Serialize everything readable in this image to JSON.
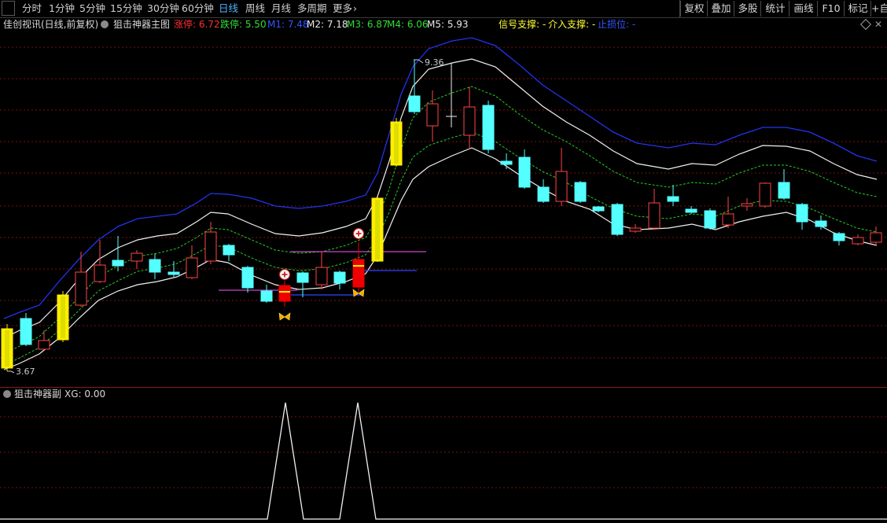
{
  "toolbar": {
    "left_box": "□",
    "periods": [
      "分时",
      "1分钟",
      "5分钟",
      "15分钟",
      "30分钟",
      "60分钟",
      "日线",
      "周线",
      "月线",
      "多周期",
      "更多"
    ],
    "active_period": "日线",
    "more_chevron": "›",
    "right_buttons": [
      "复权",
      "叠加",
      "多股",
      "统计",
      "画线",
      "F10",
      "标记",
      "+自"
    ]
  },
  "main_info": {
    "stock": "佳创视讯(日线,前复权)",
    "indicator": "狙击神器主图",
    "zt_label": "涨停: 6.72",
    "dt_label": "跌停: 5.50",
    "m1": "M1: 7.48",
    "m2": "M2: 7.18",
    "m3": "M3: 6.87",
    "m4": "M4: 6.06",
    "m5": "M5: 5.93",
    "signal": "信号支撑: -",
    "entry": "介入支撑: -",
    "stop": "止损位: -",
    "colors": {
      "zt": "#ff3030",
      "dt": "#33dd33",
      "m1": "#3355ff",
      "m2": "#e8e8e8",
      "m3": "#33dd33",
      "m4": "#33dd33",
      "m5": "#e8e8e8",
      "signal": "#ffff33",
      "entry": "#ffff33",
      "stop": "#3355ff"
    }
  },
  "price_labels": {
    "high": "9.36",
    "low": "3.67"
  },
  "sub_info": {
    "indicator": "狙击神器副",
    "xg": "XG: 0.00"
  }
}
